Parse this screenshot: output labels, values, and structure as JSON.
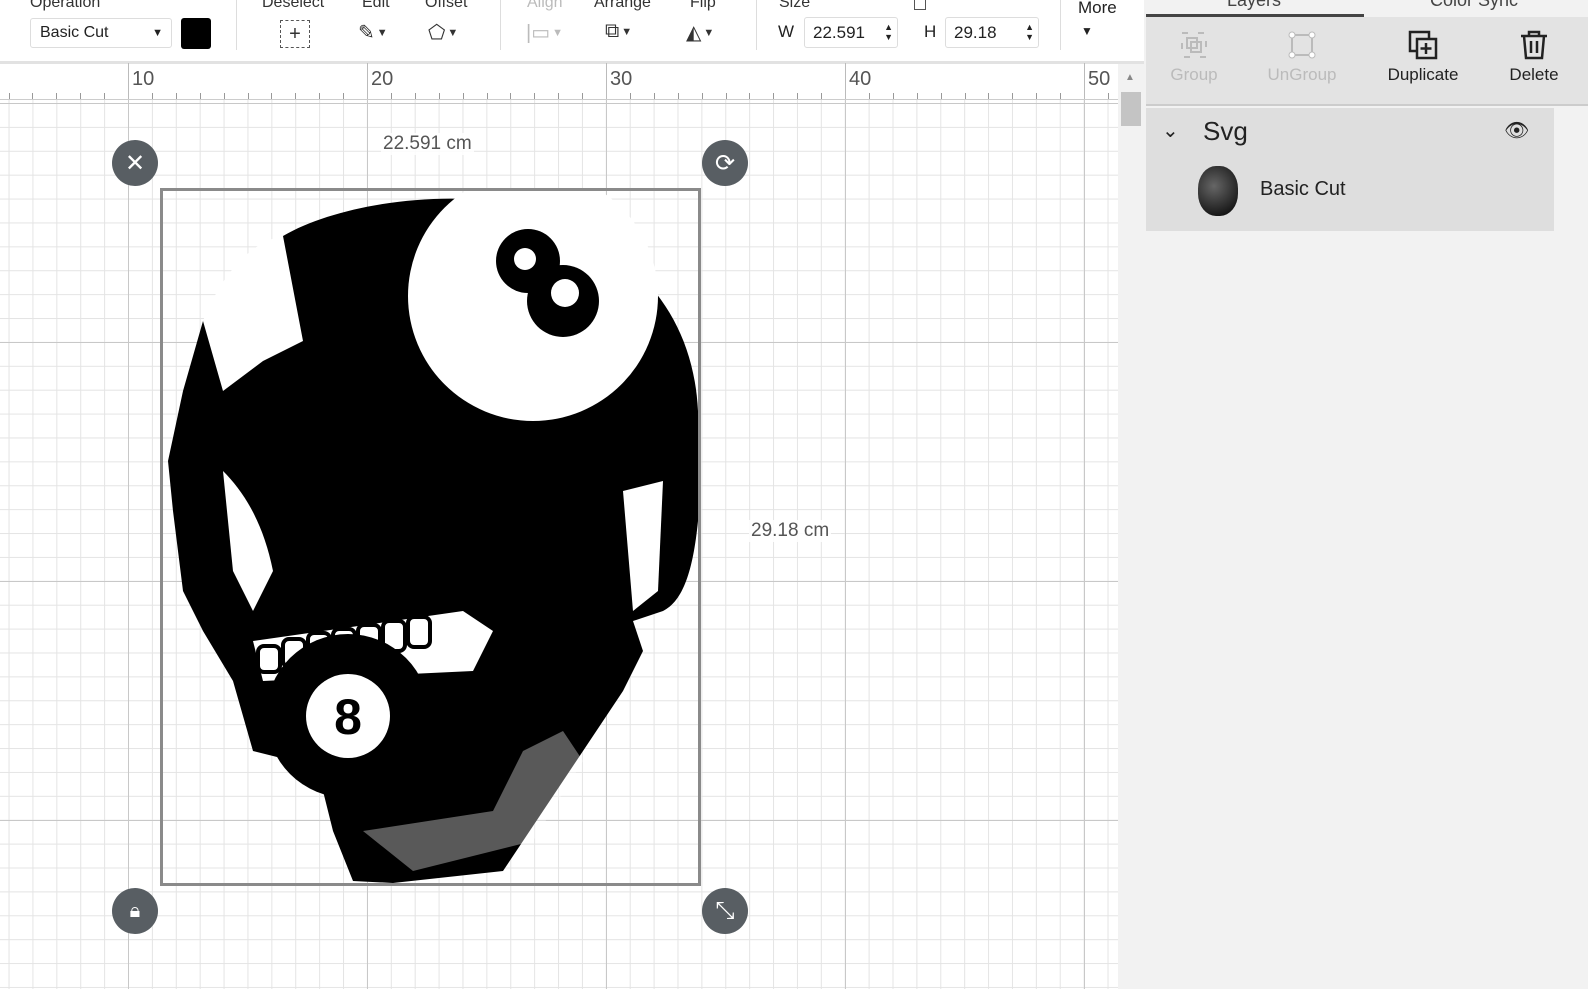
{
  "toolbar": {
    "operation_label": "Operation",
    "operation_value": "Basic Cut",
    "deselect_label": "Deselect",
    "edit_label": "Edit",
    "offset_label": "Offset",
    "align_label": "Align",
    "arrange_label": "Arrange",
    "flip_label": "Flip",
    "size_label": "Size",
    "w_label": "W",
    "w_value": "22.591",
    "h_label": "H",
    "h_value": "29.18",
    "more_label": "More",
    "color": "#000000"
  },
  "ruler": {
    "labels": [
      "10",
      "20",
      "30",
      "40",
      "50"
    ]
  },
  "canvas": {
    "width_label": "22.591 cm",
    "height_label": "29.18 cm"
  },
  "panel": {
    "tabs": [
      "Layers",
      "Color Sync"
    ],
    "actions": {
      "group": "Group",
      "ungroup": "UnGroup",
      "duplicate": "Duplicate",
      "delete": "Delete"
    },
    "layer_group": "Svg",
    "layer_item": "Basic Cut"
  }
}
